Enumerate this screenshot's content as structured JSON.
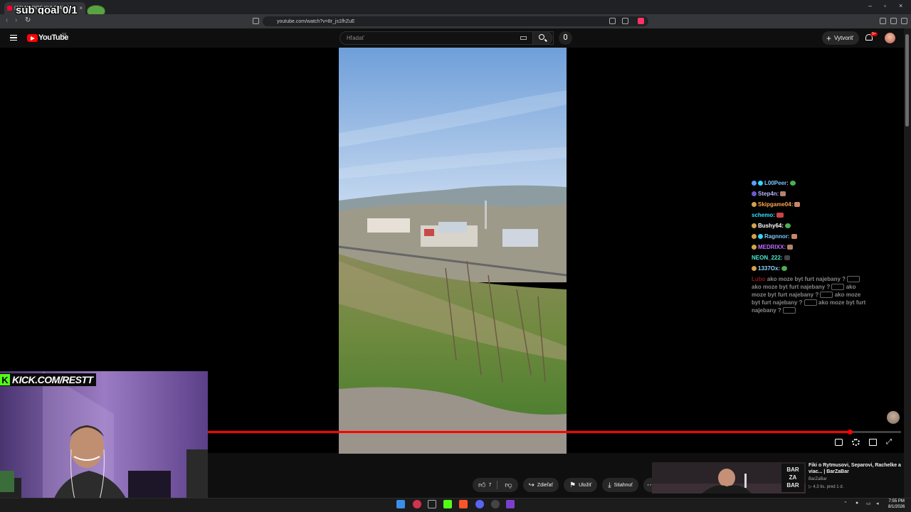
{
  "browser": {
    "tab_title": "(13) MAROŠ KULO ALIAS ...",
    "url": "youtube.com/watch?v=8r_js1fhZuE"
  },
  "overlay": {
    "sub_goal": "sub goal 0/1",
    "kick_text": "KICK.COM/RESTT",
    "kick_letter": "K"
  },
  "youtube": {
    "logo_text": "YouTube",
    "country_code": "SK",
    "search_placeholder": "Hľadať",
    "create_label": "Vytvoriť",
    "notifications_badge": "9+"
  },
  "chat": {
    "lines": [
      {
        "user": "L00Peer:",
        "color": "#7ec8ff"
      },
      {
        "user": "Step4n:",
        "color": "#b7b7ff"
      },
      {
        "user": "Skipgame04:",
        "color": "#ffa64d"
      },
      {
        "user": "schemo:",
        "color": "#34e0ff"
      },
      {
        "user": "Bushy64:",
        "color": "#ffffff"
      },
      {
        "user": "Ragnnor:",
        "color": "#7ec8ff"
      },
      {
        "user": "MEDRIXX:",
        "color": "#c06bff"
      },
      {
        "user": "NEON_222:",
        "color": "#4ee8d0"
      },
      {
        "user": "1337Ox:",
        "color": "#8fd4ff"
      }
    ],
    "spam_user": "Lubo",
    "spam_text": "ako moze byt furt najebany ?"
  },
  "player": {
    "progress": 0.926
  },
  "actions": {
    "like_count": "7",
    "share": "Zdieľať",
    "save": "Uložiť",
    "download": "Stiahnuť"
  },
  "recommended": {
    "title": "Fiki o Rytmusovi, Separovi, Rachelke a viac... | BarZaBar",
    "channel": "BarZaBar",
    "meta": "▷ 4,3 tis.   pred 1 d.",
    "thumb_logo": "BAR ZA BAR"
  },
  "taskbar": {
    "time": "7:55 PM",
    "date": "8/1/2026"
  }
}
